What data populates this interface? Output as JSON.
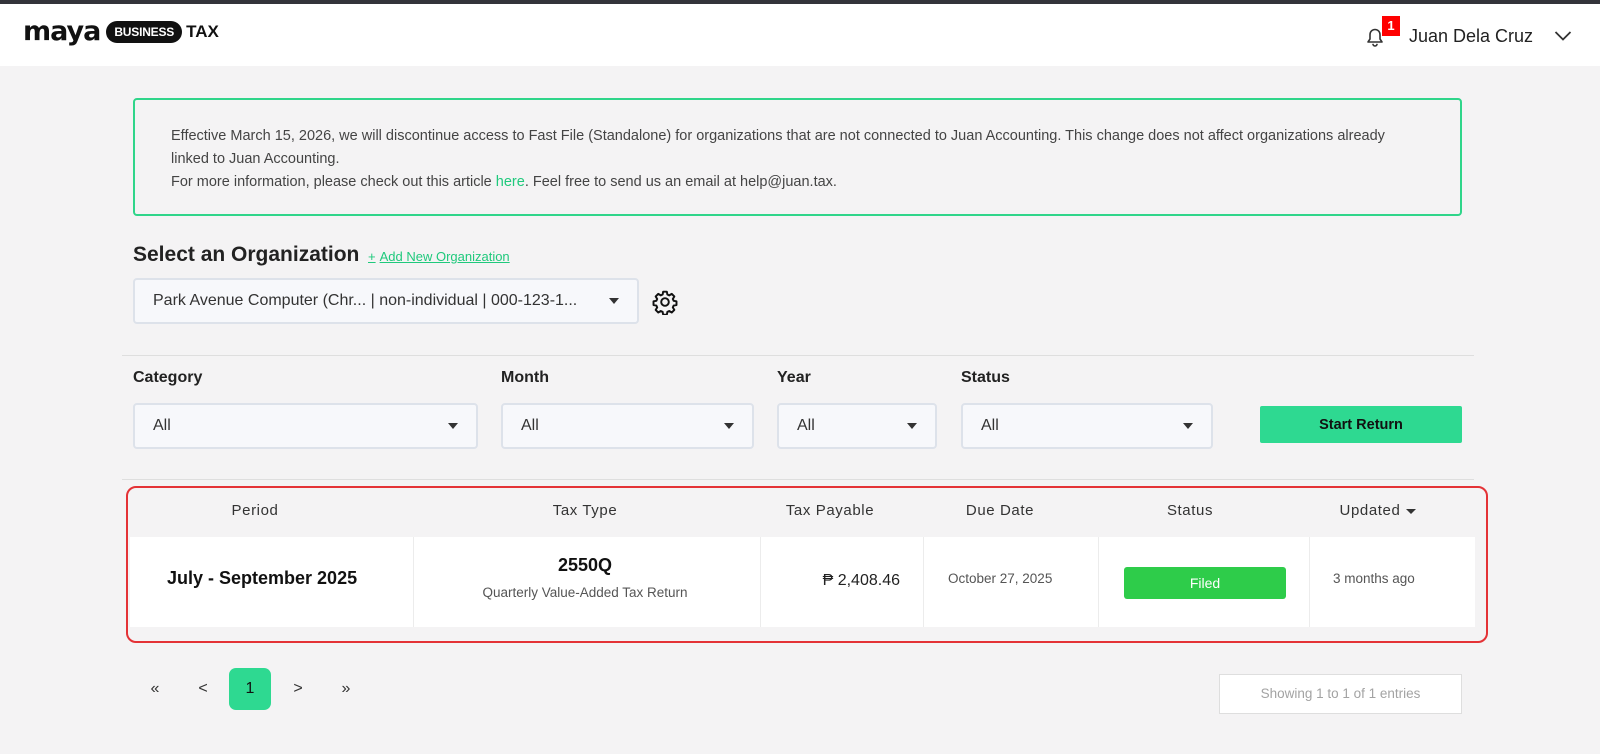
{
  "header": {
    "logo": {
      "word": "maya",
      "pill": "BUSINESS",
      "suffix": "TAX"
    },
    "notification_count": "1",
    "user_name": "Juan Dela Cruz"
  },
  "notice": {
    "line1": "Effective March 15, 2026, we will discontinue access to Fast File (Standalone) for organizations that are not connected to Juan Accounting. This change does not affect organizations already linked to Juan Accounting.",
    "line2_prefix": "For more information, please check out this article ",
    "line2_link": "here",
    "line2_suffix": ". Feel free to send us an email at help@juan.tax."
  },
  "organization": {
    "title": "Select an Organization",
    "add_plus": "+",
    "add_label": "Add New Organization",
    "selected": "Park Avenue Computer (Chr... | non-individual | 000-123-1..."
  },
  "filters": {
    "category": {
      "label": "Category",
      "value": "All"
    },
    "month": {
      "label": "Month",
      "value": "All"
    },
    "year": {
      "label": "Year",
      "value": "All"
    },
    "status": {
      "label": "Status",
      "value": "All"
    },
    "start_button": "Start Return"
  },
  "table": {
    "headers": [
      "Period",
      "Tax Type",
      "Tax Payable",
      "Due Date",
      "Status",
      "Updated"
    ],
    "rows": [
      {
        "period": "July - September 2025",
        "tax_code": "2550Q",
        "tax_desc": "Quarterly Value-Added Tax Return",
        "payable": "₱ 2,408.46",
        "due_date": "October 27, 2025",
        "status": "Filed",
        "updated": "3 months ago"
      }
    ]
  },
  "pagination": {
    "first": "«",
    "prev": "<",
    "current": "1",
    "next": ">",
    "last": "»",
    "showing": "Showing 1 to 1 of 1 entries"
  },
  "colors": {
    "accent": "#2ed991",
    "filed": "#2ecc4a",
    "highlight": "#e43236",
    "notice_border": "#2fd58a"
  }
}
